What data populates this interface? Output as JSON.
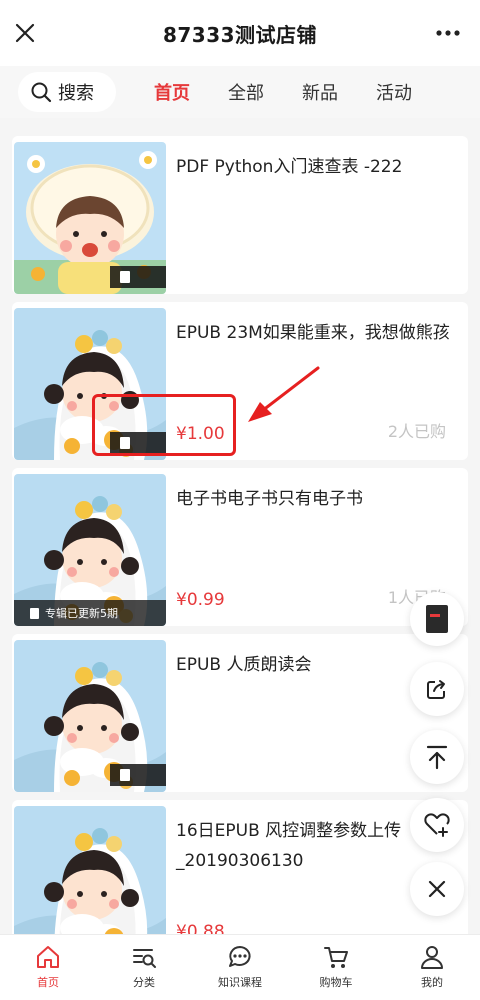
{
  "header": {
    "title": "87333测试店铺",
    "close_icon": "close-icon",
    "more_icon": "more-icon"
  },
  "nav": {
    "search_label": "搜索",
    "tabs": [
      {
        "label": "首页",
        "active": true
      },
      {
        "label": "全部",
        "active": false
      },
      {
        "label": "新品",
        "active": false
      },
      {
        "label": "活动",
        "active": false
      }
    ]
  },
  "products": [
    {
      "title": "PDF Python入门速查表 -222",
      "price": "",
      "sold": "",
      "badge": "",
      "cover": "girl-yellow-hat"
    },
    {
      "title": "EPUB 23M如果能重来，我想做熊孩",
      "price": "¥1.00",
      "sold": "2人已购",
      "badge": "",
      "cover": "girl-flowers"
    },
    {
      "title": "电子书电子书只有电子书",
      "price": "¥0.99",
      "sold": "1人已购",
      "badge": "专辑已更新5期",
      "cover": "girl-flowers"
    },
    {
      "title": "EPUB 人质朗读会",
      "price": "",
      "sold": "",
      "badge": "",
      "cover": "girl-flowers"
    },
    {
      "title": "16日EPUB 风控调整参数上传_20190306130",
      "price": "¥0.88",
      "sold": "",
      "badge": "",
      "cover": "girl-flowers"
    }
  ],
  "floating_buttons": [
    "book-thumbnail",
    "share-icon",
    "back-to-top-icon",
    "favorite-add-icon",
    "close-icon"
  ],
  "bottom_nav": [
    {
      "label": "首页",
      "icon": "home-icon",
      "active": true
    },
    {
      "label": "分类",
      "icon": "category-icon",
      "active": false
    },
    {
      "label": "知识课程",
      "icon": "chat-icon",
      "active": false
    },
    {
      "label": "购物车",
      "icon": "cart-icon",
      "active": false
    },
    {
      "label": "我的",
      "icon": "profile-icon",
      "active": false
    }
  ],
  "colors": {
    "accent": "#e6393b",
    "annotation": "#e62020",
    "sold_text": "#c4c4c4"
  }
}
